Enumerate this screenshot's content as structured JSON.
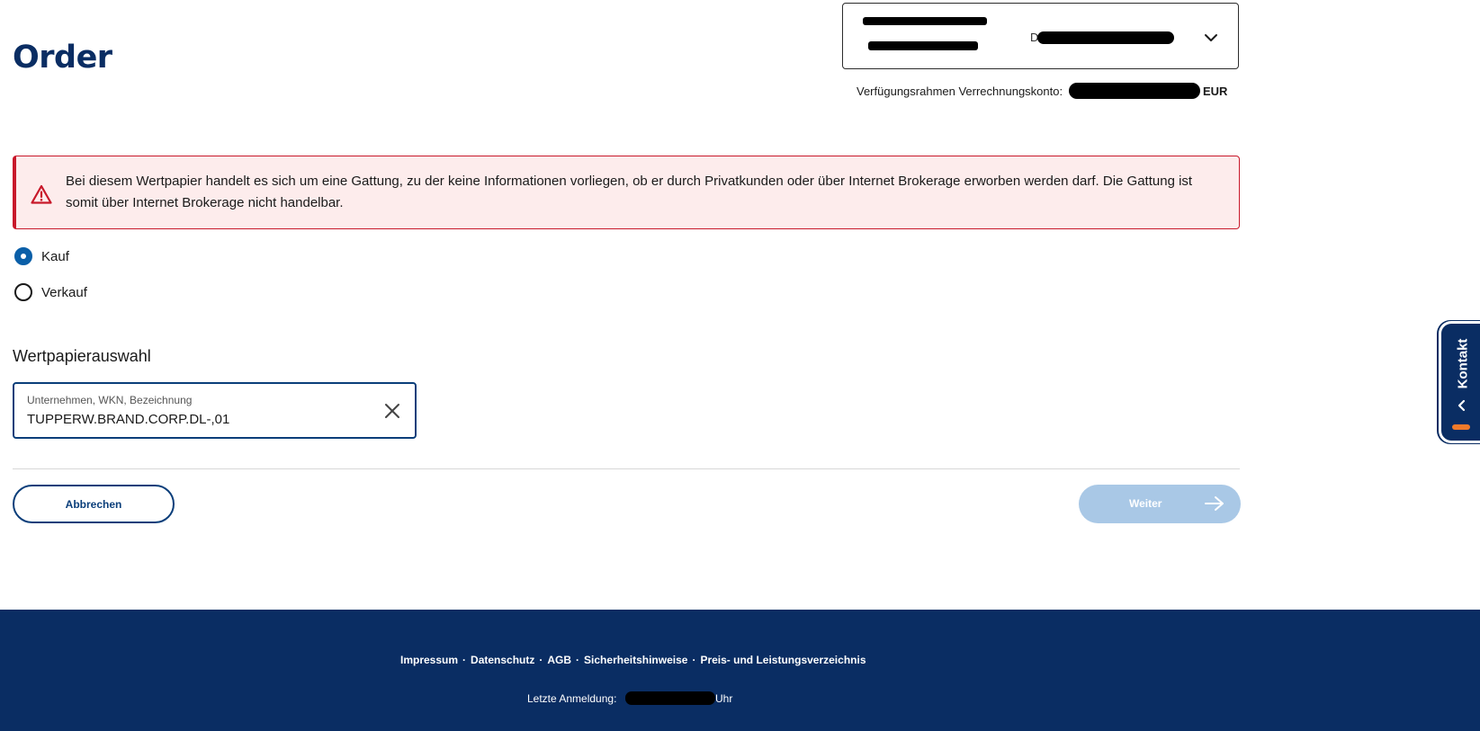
{
  "page": {
    "title": "Order"
  },
  "account": {
    "prefix": "D"
  },
  "balance": {
    "label": "Verfügungsrahmen Verrechnungskonto:",
    "currency": "EUR"
  },
  "alert": {
    "message": "Bei diesem Wertpapier handelt es sich um eine Gattung, zu der keine Informationen vorliegen, ob er durch Privatkunden oder über Internet Brokerage erworben werden darf. Die Gattung ist somit über Internet Brokerage nicht handelbar."
  },
  "order_type": {
    "options": [
      {
        "label": "Kauf",
        "checked": true
      },
      {
        "label": "Verkauf",
        "checked": false
      }
    ]
  },
  "security": {
    "section_label": "Wertpapierauswahl",
    "field_label": "Unternehmen, WKN, Bezeichnung",
    "value": "TUPPERW.BRAND.CORP.DL-,01"
  },
  "actions": {
    "cancel": "Abbrechen",
    "next": "Weiter"
  },
  "contact": {
    "label": "Kontakt"
  },
  "footer": {
    "links": [
      "Impressum",
      "Datenschutz",
      "AGB",
      "Sicherheitshinweise",
      "Preis- und Leistungsverzeichnis"
    ],
    "separator": "·",
    "last_login_label": "Letzte Anmeldung:",
    "last_login_suffix": "Uhr"
  },
  "colors": {
    "brand": "#0a2d63",
    "accent": "#0a5fa8",
    "error": "#c8182a",
    "error_bg": "#fdecec",
    "disabled_button": "#a9c8e6",
    "contact_indicator": "#f07a2a"
  }
}
